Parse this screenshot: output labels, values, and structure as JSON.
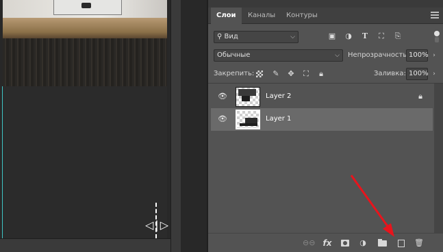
{
  "tabs": [
    {
      "label": "Слои",
      "active": true
    },
    {
      "label": "Каналы",
      "active": false
    },
    {
      "label": "Контуры",
      "active": false
    }
  ],
  "filter": {
    "kind_label": "Вид",
    "icons": [
      "image-filter-icon",
      "adjustment-filter-icon",
      "type-filter-icon",
      "shape-filter-icon",
      "smart-object-filter-icon"
    ]
  },
  "blend": {
    "mode": "Обычные",
    "opacity_label": "Непрозрачность:",
    "opacity_value": "100%"
  },
  "lock": {
    "label": "Закрепить:",
    "icons": [
      "lock-transparent-pixels-icon",
      "lock-image-pixels-icon",
      "lock-position-icon",
      "lock-artboard-icon",
      "lock-all-icon"
    ],
    "fill_label": "Заливка:",
    "fill_value": "100%"
  },
  "layers": [
    {
      "name": "Layer 2",
      "visible": true,
      "locked": true,
      "selected": false
    },
    {
      "name": "Layer 1",
      "visible": true,
      "locked": false,
      "selected": true
    }
  ],
  "bottom_bar": {
    "fx_label": "fx",
    "icons": [
      "link-layers-icon",
      "fx-icon",
      "layer-mask-icon",
      "adjustment-layer-icon",
      "group-folder-icon",
      "new-layer-icon",
      "trash-icon"
    ]
  },
  "colors": {
    "panel_bg": "#535353",
    "selected_row": "#6a6a6a",
    "guide_cyan": "#3fc6c6",
    "annotation_red": "#e8141c"
  }
}
